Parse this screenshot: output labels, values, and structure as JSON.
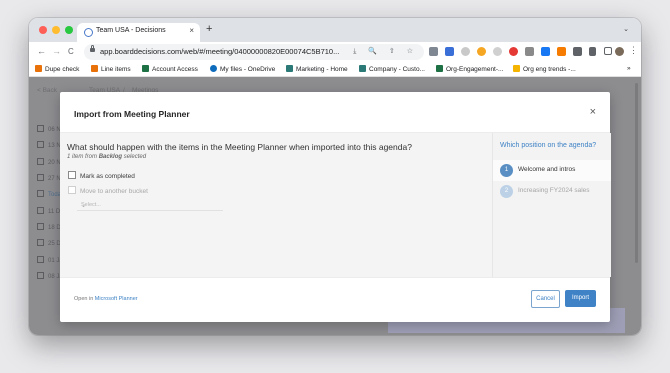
{
  "browser": {
    "tab_title": "Team USA - Decisions",
    "tab_close": "×",
    "new_tab": "+",
    "tab_menu": "⌄",
    "url": "app.boarddecisions.com/web/#/meeting/04000000820E00074C5B710...",
    "nav_back": "←",
    "nav_forward": "→",
    "reload": "C",
    "omnibox_icons": "⤓ 🔍 ⇧ ☆",
    "menu": "⋮"
  },
  "bookmarks": [
    {
      "label": "Dupe check",
      "color": "#e8710a"
    },
    {
      "label": "Line items",
      "color": "#e8710a"
    },
    {
      "label": "Account Access",
      "color": "#1e7145"
    },
    {
      "label": "My files - OneDrive",
      "color": "#0f6cbd"
    },
    {
      "label": "Marketing - Home",
      "color": "#2b7a78"
    },
    {
      "label": "Company - Custo...",
      "color": "#2b7a78"
    },
    {
      "label": "Org-Engagement-...",
      "color": "#1e7145"
    },
    {
      "label": "Org eng trends -...",
      "color": "#f4b400"
    }
  ],
  "bookmarks_more": "»",
  "background": {
    "back": "< Back",
    "crumb_team": "Team USA",
    "crumb_sep": "/",
    "crumb_meetings": "Meetings",
    "dates": [
      "06 N",
      "13 N",
      "20 N",
      "27 N",
      "Toda",
      "11 D",
      "18 D",
      "25 D",
      "01 Ja",
      "08 Ja"
    ]
  },
  "modal": {
    "title": "Import from Meeting Planner",
    "close": "×",
    "question": "What should happen with the items in the Meeting Planner when imported into this agenda?",
    "sub_count": "1 item from",
    "sub_source": "Backlog",
    "sub_suffix": "selected",
    "option_complete": "Mark as completed",
    "option_move": "Move to another bucket",
    "select_placeholder": "Select...",
    "select_chevron": "⌄",
    "positions_title": "Which position on the agenda?",
    "positions": [
      {
        "num": "1",
        "label": "Welcome and intros"
      },
      {
        "num": "2",
        "label": "Increasing FY2024 sales"
      }
    ],
    "open_in_prefix": "Open in",
    "open_in_link": "Microsoft Planner",
    "cancel_label": "Cancel",
    "import_label": "Import"
  },
  "colors": {
    "accent": "#3f82c6",
    "overlay": "#8d8d90"
  }
}
